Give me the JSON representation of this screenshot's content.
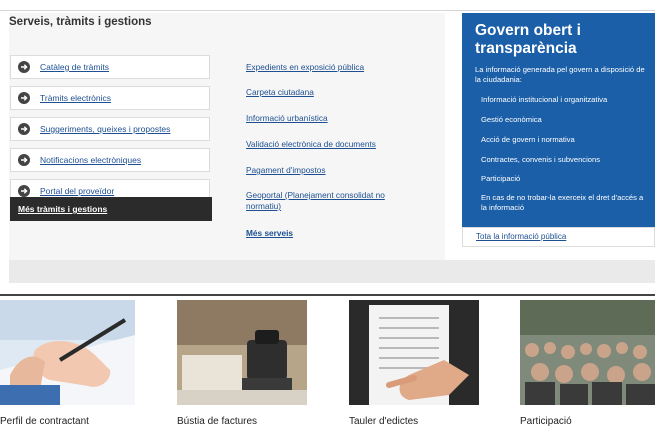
{
  "services": {
    "title": "Serveis, tràmits i gestions",
    "boxes": [
      {
        "label": "Catàleg de tràmits"
      },
      {
        "label": "Tràmits electrònics"
      },
      {
        "label": "Suggeriments, queixes i propostes"
      },
      {
        "label": "Notificacions electròniques"
      },
      {
        "label": "Portal del proveïdor"
      }
    ],
    "more_label": "Més tràmits i gestions",
    "links": [
      "Expedients en exposició pública",
      "Carpeta ciutadana",
      "Informació urbanística",
      "Validació electrònica de documents",
      "Pagament d'impostos",
      "Geoportal (Planejament consolidat no normatiu)"
    ],
    "more_services": "Més serveis"
  },
  "gov": {
    "title": "Govern obert i transparència",
    "intro": "La informació generada pel govern a disposició de la ciudadania:",
    "items": [
      "Informació institucional i organitzativa",
      "Gestió econòmica",
      "Acció de govern i normativa",
      "Contractes, convenis i subvencions",
      "Participació"
    ],
    "note": "En cas de no trobar-la exerceix el dret d'accés a la informació",
    "all_link": "Tota la informació pública"
  },
  "tiles": [
    {
      "caption": "Perfil de contractant",
      "icon": "hand-writing-image"
    },
    {
      "caption": "Bústia de factures",
      "icon": "stamp-image"
    },
    {
      "caption": "Tauler d'edictes",
      "icon": "pointing-document-image"
    },
    {
      "caption": "Participació",
      "icon": "crowd-image"
    }
  ],
  "colors": {
    "accent_blue": "#1b5fa8",
    "link_blue": "#1d4f91",
    "dark_button": "#2b2b2b"
  }
}
